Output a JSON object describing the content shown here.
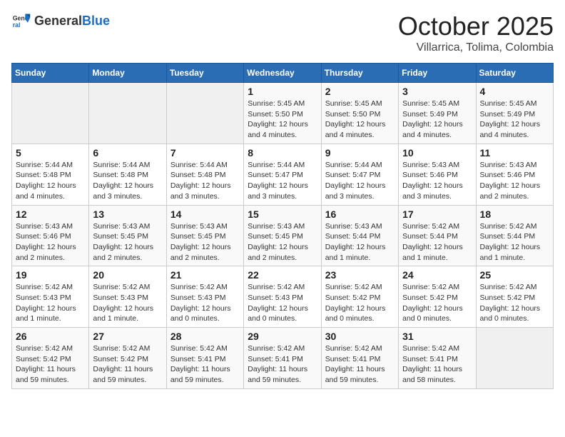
{
  "header": {
    "logo": {
      "general": "General",
      "blue": "Blue"
    },
    "title": "October 2025",
    "location": "Villarrica, Tolima, Colombia"
  },
  "weekdays": [
    "Sunday",
    "Monday",
    "Tuesday",
    "Wednesday",
    "Thursday",
    "Friday",
    "Saturday"
  ],
  "weeks": [
    [
      {
        "day": "",
        "info": ""
      },
      {
        "day": "",
        "info": ""
      },
      {
        "day": "",
        "info": ""
      },
      {
        "day": "1",
        "info": "Sunrise: 5:45 AM\nSunset: 5:50 PM\nDaylight: 12 hours\nand 4 minutes."
      },
      {
        "day": "2",
        "info": "Sunrise: 5:45 AM\nSunset: 5:50 PM\nDaylight: 12 hours\nand 4 minutes."
      },
      {
        "day": "3",
        "info": "Sunrise: 5:45 AM\nSunset: 5:49 PM\nDaylight: 12 hours\nand 4 minutes."
      },
      {
        "day": "4",
        "info": "Sunrise: 5:45 AM\nSunset: 5:49 PM\nDaylight: 12 hours\nand 4 minutes."
      }
    ],
    [
      {
        "day": "5",
        "info": "Sunrise: 5:44 AM\nSunset: 5:48 PM\nDaylight: 12 hours\nand 4 minutes."
      },
      {
        "day": "6",
        "info": "Sunrise: 5:44 AM\nSunset: 5:48 PM\nDaylight: 12 hours\nand 3 minutes."
      },
      {
        "day": "7",
        "info": "Sunrise: 5:44 AM\nSunset: 5:48 PM\nDaylight: 12 hours\nand 3 minutes."
      },
      {
        "day": "8",
        "info": "Sunrise: 5:44 AM\nSunset: 5:47 PM\nDaylight: 12 hours\nand 3 minutes."
      },
      {
        "day": "9",
        "info": "Sunrise: 5:44 AM\nSunset: 5:47 PM\nDaylight: 12 hours\nand 3 minutes."
      },
      {
        "day": "10",
        "info": "Sunrise: 5:43 AM\nSunset: 5:46 PM\nDaylight: 12 hours\nand 3 minutes."
      },
      {
        "day": "11",
        "info": "Sunrise: 5:43 AM\nSunset: 5:46 PM\nDaylight: 12 hours\nand 2 minutes."
      }
    ],
    [
      {
        "day": "12",
        "info": "Sunrise: 5:43 AM\nSunset: 5:46 PM\nDaylight: 12 hours\nand 2 minutes."
      },
      {
        "day": "13",
        "info": "Sunrise: 5:43 AM\nSunset: 5:45 PM\nDaylight: 12 hours\nand 2 minutes."
      },
      {
        "day": "14",
        "info": "Sunrise: 5:43 AM\nSunset: 5:45 PM\nDaylight: 12 hours\nand 2 minutes."
      },
      {
        "day": "15",
        "info": "Sunrise: 5:43 AM\nSunset: 5:45 PM\nDaylight: 12 hours\nand 2 minutes."
      },
      {
        "day": "16",
        "info": "Sunrise: 5:43 AM\nSunset: 5:44 PM\nDaylight: 12 hours\nand 1 minute."
      },
      {
        "day": "17",
        "info": "Sunrise: 5:42 AM\nSunset: 5:44 PM\nDaylight: 12 hours\nand 1 minute."
      },
      {
        "day": "18",
        "info": "Sunrise: 5:42 AM\nSunset: 5:44 PM\nDaylight: 12 hours\nand 1 minute."
      }
    ],
    [
      {
        "day": "19",
        "info": "Sunrise: 5:42 AM\nSunset: 5:43 PM\nDaylight: 12 hours\nand 1 minute."
      },
      {
        "day": "20",
        "info": "Sunrise: 5:42 AM\nSunset: 5:43 PM\nDaylight: 12 hours\nand 1 minute."
      },
      {
        "day": "21",
        "info": "Sunrise: 5:42 AM\nSunset: 5:43 PM\nDaylight: 12 hours\nand 0 minutes."
      },
      {
        "day": "22",
        "info": "Sunrise: 5:42 AM\nSunset: 5:43 PM\nDaylight: 12 hours\nand 0 minutes."
      },
      {
        "day": "23",
        "info": "Sunrise: 5:42 AM\nSunset: 5:42 PM\nDaylight: 12 hours\nand 0 minutes."
      },
      {
        "day": "24",
        "info": "Sunrise: 5:42 AM\nSunset: 5:42 PM\nDaylight: 12 hours\nand 0 minutes."
      },
      {
        "day": "25",
        "info": "Sunrise: 5:42 AM\nSunset: 5:42 PM\nDaylight: 12 hours\nand 0 minutes."
      }
    ],
    [
      {
        "day": "26",
        "info": "Sunrise: 5:42 AM\nSunset: 5:42 PM\nDaylight: 11 hours\nand 59 minutes."
      },
      {
        "day": "27",
        "info": "Sunrise: 5:42 AM\nSunset: 5:42 PM\nDaylight: 11 hours\nand 59 minutes."
      },
      {
        "day": "28",
        "info": "Sunrise: 5:42 AM\nSunset: 5:41 PM\nDaylight: 11 hours\nand 59 minutes."
      },
      {
        "day": "29",
        "info": "Sunrise: 5:42 AM\nSunset: 5:41 PM\nDaylight: 11 hours\nand 59 minutes."
      },
      {
        "day": "30",
        "info": "Sunrise: 5:42 AM\nSunset: 5:41 PM\nDaylight: 11 hours\nand 59 minutes."
      },
      {
        "day": "31",
        "info": "Sunrise: 5:42 AM\nSunset: 5:41 PM\nDaylight: 11 hours\nand 58 minutes."
      },
      {
        "day": "",
        "info": ""
      }
    ]
  ]
}
